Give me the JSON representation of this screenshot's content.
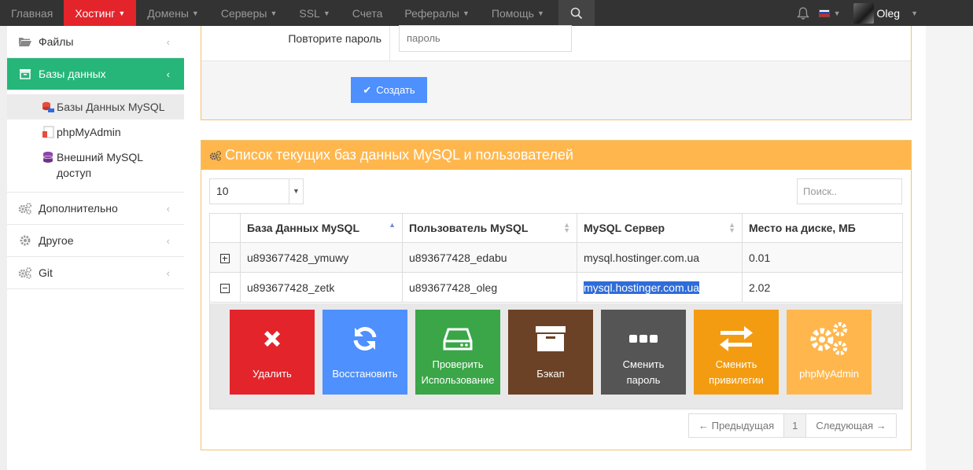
{
  "nav": {
    "items": [
      {
        "label": "Главная",
        "has_menu": false
      },
      {
        "label": "Хостинг",
        "has_menu": true,
        "active": true
      },
      {
        "label": "Домены",
        "has_menu": true
      },
      {
        "label": "Серверы",
        "has_menu": true
      },
      {
        "label": "SSL",
        "has_menu": true
      },
      {
        "label": "Счета",
        "has_menu": false
      },
      {
        "label": "Рефералы",
        "has_menu": true
      },
      {
        "label": "Помощь",
        "has_menu": true
      }
    ],
    "user_name": "Oleg"
  },
  "sidebar": {
    "items": [
      {
        "label": "Файлы"
      },
      {
        "label": "Базы данных"
      },
      {
        "label": "Дополнительно"
      },
      {
        "label": "Другое"
      },
      {
        "label": "Git"
      }
    ],
    "sub_items": [
      {
        "label": "Базы Данных MySQL"
      },
      {
        "label": "phpMyAdmin"
      },
      {
        "label": "Внешний MySQL доступ"
      }
    ]
  },
  "form": {
    "repeat_password_label": "Повторите пароль",
    "password_placeholder": "пароль",
    "create_button": "Создать"
  },
  "list": {
    "title": "Список текущих баз данных MySQL и пользователей",
    "page_size": "10",
    "search_placeholder": "Поиск..",
    "columns": [
      "База Данных MySQL",
      "Пользователь MySQL",
      "MySQL Сервер",
      "Место на диске, МБ"
    ],
    "rows": [
      {
        "database": "u893677428_ymuwy",
        "user": "u893677428_edabu",
        "server": "mysql.hostinger.com.ua",
        "size": "0.01"
      },
      {
        "database": "u893677428_zetk",
        "user": "u893677428_oleg",
        "server": "mysql.hostinger.com.ua",
        "size": "2.02"
      }
    ],
    "actions": [
      {
        "label": "Удалить",
        "color": "#e3242b"
      },
      {
        "label": "Восстановить",
        "color": "#4d90fe"
      },
      {
        "label": "Проверить Использование",
        "color": "#3aa648"
      },
      {
        "label": "Бэкап",
        "color": "#6b4226"
      },
      {
        "label": "Сменить пароль",
        "color": "#555555"
      },
      {
        "label": "Сменить привилегии",
        "color": "#f39c12"
      },
      {
        "label": "phpMyAdmin",
        "color": "#ffb74d"
      }
    ],
    "pager": {
      "prev": "← Предыдущая",
      "page": "1",
      "next": "Следующая →"
    }
  },
  "colors": {
    "nav_bg": "#333333",
    "nav_active": "#e3242b",
    "sidebar_active": "#26b67a",
    "panel_header": "#ffb74d",
    "primary_button": "#4d90fe"
  }
}
